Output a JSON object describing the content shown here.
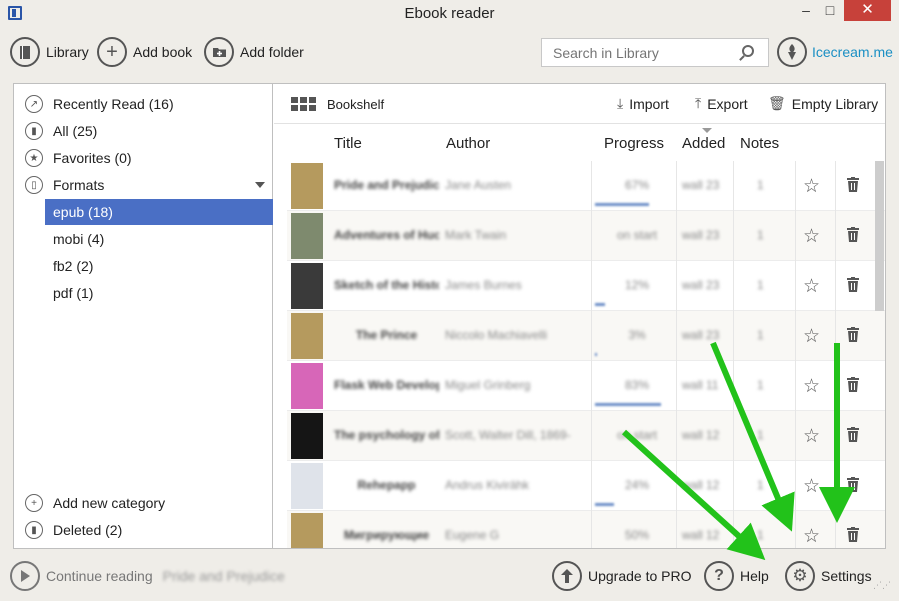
{
  "window": {
    "title": "Ebook reader",
    "minimize": "‒",
    "maximize": "□",
    "close": "✕"
  },
  "toolbar": {
    "library": "Library",
    "add_book": "Add book",
    "add_folder": "Add folder",
    "search_placeholder": "Search in Library",
    "brand": "Icecream.me"
  },
  "sidebar": {
    "recent": "Recently Read (16)",
    "all": "All (25)",
    "favorites": "Favorites (0)",
    "formats": "Formats",
    "format_items": [
      "epub (18)",
      "mobi (4)",
      "fb2 (2)",
      "pdf (1)"
    ],
    "add_category": "Add new category",
    "deleted": "Deleted (2)"
  },
  "shelf": {
    "view": "Bookshelf",
    "import": "Import",
    "export": "Export",
    "empty": "Empty Library"
  },
  "columns": {
    "title": "Title",
    "author": "Author",
    "progress": "Progress",
    "added": "Added",
    "notes": "Notes"
  },
  "books": [
    {
      "title": "Pride and Prejudice",
      "author": "Jane Austen",
      "progress": "67%",
      "progress_value": 0.67,
      "added": "wall 23",
      "notes": "1",
      "cover": "#b59a5e"
    },
    {
      "title": "Adventures of Huckleberry Finn",
      "author": "Mark Twain",
      "progress": "on start",
      "progress_value": 0,
      "added": "wall 23",
      "notes": "1",
      "cover": "#7e8a6e"
    },
    {
      "title": "Sketch of the History",
      "author": "James Burnes",
      "progress": "12%",
      "progress_value": 0.12,
      "added": "wall 23",
      "notes": "1",
      "cover": "#3a3a3a"
    },
    {
      "title": "The Prince",
      "author": "Niccolo Machiavelli",
      "progress": "3%",
      "progress_value": 0.03,
      "added": "wall 23",
      "notes": "1",
      "cover": "#b59a5e"
    },
    {
      "title": "Flask Web Development",
      "author": "Miguel Grinberg",
      "progress": "83%",
      "progress_value": 0.83,
      "added": "wall 11",
      "notes": "1",
      "cover": "#d766b8"
    },
    {
      "title": "The psychology of",
      "author": "Scott, Walter Dill, 1869-",
      "progress": "on start",
      "progress_value": 0,
      "added": "wall 12",
      "notes": "1",
      "cover": "#151515"
    },
    {
      "title": "Rehepapp",
      "author": "Andrus Kivirähk",
      "progress": "24%",
      "progress_value": 0.24,
      "added": "wall 12",
      "notes": "1",
      "cover": "#dfe3ea"
    },
    {
      "title": "Мигрирующие",
      "author": "Eugene G",
      "progress": "50%",
      "progress_value": 0.5,
      "added": "wall 12",
      "notes": "1",
      "cover": "#b59a5e"
    }
  ],
  "bottom": {
    "continue": "Continue reading",
    "continue_book": "Pride and Prejudice",
    "upgrade": "Upgrade to PRO",
    "help": "Help",
    "settings": "Settings"
  },
  "colors": {
    "accent": "#4a6fc5",
    "brand": "#1a8fc4",
    "arrow": "#22c21a",
    "close": "#c7413a"
  }
}
